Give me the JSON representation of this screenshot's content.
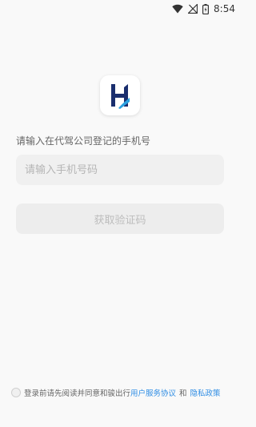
{
  "status_bar": {
    "time": "8:54",
    "icons": [
      "wifi-icon",
      "no-signal-icon",
      "battery-icon"
    ]
  },
  "app": {
    "logo": "app-logo",
    "brand_colors": {
      "logo_dark": "#1a2e6e",
      "logo_light": "#2aa0e0"
    }
  },
  "login": {
    "prompt": "请输入在代驾公司登记的手机号",
    "phone_placeholder": "请输入手机号码",
    "phone_value": "",
    "get_code_label": "获取验证码"
  },
  "agreement": {
    "checked": false,
    "text": "登录前请先阅读并同意和骏出行",
    "user_agreement_link": "用户服务协议",
    "and_text": "和",
    "privacy_link": "隐私政策",
    "link_color": "#2f8de4"
  }
}
